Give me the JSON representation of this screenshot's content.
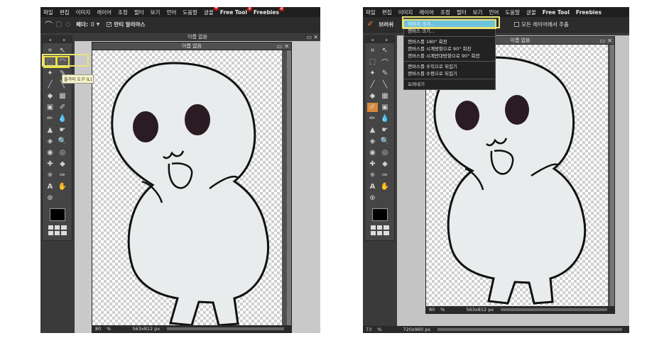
{
  "left": {
    "menu": [
      {
        "label": "파일"
      },
      {
        "label": "편집"
      },
      {
        "label": "이미지"
      },
      {
        "label": "레이어"
      },
      {
        "label": "조정"
      },
      {
        "label": "필터"
      },
      {
        "label": "보기"
      },
      {
        "label": "언어"
      },
      {
        "label": "도움말"
      },
      {
        "label": "글꼴",
        "badge": "4"
      },
      {
        "label": "Free Tool",
        "badge": "1",
        "bold": true
      },
      {
        "label": "Freebies",
        "badge": "2",
        "bold": true
      }
    ],
    "options": {
      "feather_label": "페더:",
      "feather_value": "0",
      "antialias_label": "안티 알리아스",
      "antialias_checked": true
    },
    "tooltip": "올가미 도구 (L)",
    "back_window_title": "이름 없음",
    "doc_title": "이름 없음",
    "status": {
      "zoom": "80",
      "zoom_unit": "%",
      "size": "563x812 px"
    }
  },
  "right": {
    "menu": [
      {
        "label": "파일"
      },
      {
        "label": "편집"
      },
      {
        "label": "이미지"
      },
      {
        "label": "레이어"
      },
      {
        "label": "조정"
      },
      {
        "label": "필터"
      },
      {
        "label": "보기"
      },
      {
        "label": "언어"
      },
      {
        "label": "도움말"
      },
      {
        "label": "글꼴"
      },
      {
        "label": "Free Tool",
        "bold": true
      },
      {
        "label": "Freebies",
        "bold": true
      }
    ],
    "options": {
      "brush_label": "브러쉬",
      "sample_all_label": "모든 레이어에서 추출"
    },
    "dropdown": {
      "items": [
        {
          "label": "이미지 크기...",
          "active": true
        },
        {
          "label": "캔버스 크기..."
        },
        {
          "sep": true
        },
        {
          "label": "캔버스를 180° 회전"
        },
        {
          "label": "캔버스를 시계방향으로 90° 회전"
        },
        {
          "label": "캔버스를 시계반대방향으로 90° 회전"
        },
        {
          "sep": true
        },
        {
          "label": "캔버스를 수직으로 뒤집기"
        },
        {
          "label": "캔버스를 수평으로 뒤집기"
        },
        {
          "sep": true
        },
        {
          "label": "오려내기"
        }
      ]
    },
    "doc_title": "이름 없음",
    "status": {
      "zoom": "80",
      "zoom_unit": "%",
      "size": "563x812 px"
    },
    "outer_status": {
      "zoom": "73",
      "zoom_unit": "%",
      "size": "720x960 px"
    }
  },
  "colors": {
    "menubar": "#1f1f1f",
    "panel": "#454545",
    "highlight": "#e8e478",
    "active_item": "#6ec2de",
    "badge": "#d11b1b"
  }
}
